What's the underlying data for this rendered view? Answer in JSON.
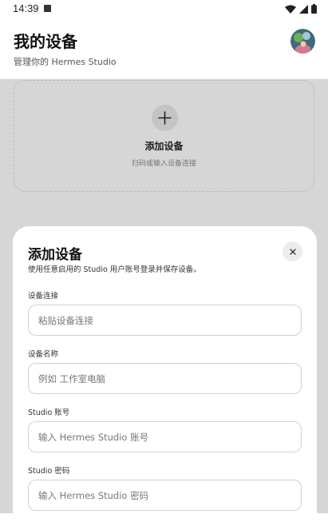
{
  "status_bar": {
    "time": "14:39"
  },
  "header": {
    "title": "我的设备",
    "subtitle": "管理你的 Hermes Studio"
  },
  "add_card": {
    "label": "添加设备",
    "hint": "扫码或输入设备连接"
  },
  "sheet": {
    "title": "添加设备",
    "description": "使用任意启用的 Studio 用户账号登录并保存设备。",
    "fields": [
      {
        "label": "设备连接",
        "placeholder": "粘贴设备连接"
      },
      {
        "label": "设备名称",
        "placeholder": "例如 工作室电脑"
      },
      {
        "label": "Studio 账号",
        "placeholder": "输入 Hermes Studio 账号"
      },
      {
        "label": "Studio 密码",
        "placeholder": "输入 Hermes Studio 密码"
      }
    ]
  },
  "colors": {
    "backdrop": "#d6d6d6",
    "sheet": "#ffffff",
    "field_border": "#d2d2d2"
  },
  "icons": [
    "wifi-icon",
    "cellular-icon",
    "battery-icon",
    "plus-icon",
    "close-icon"
  ]
}
